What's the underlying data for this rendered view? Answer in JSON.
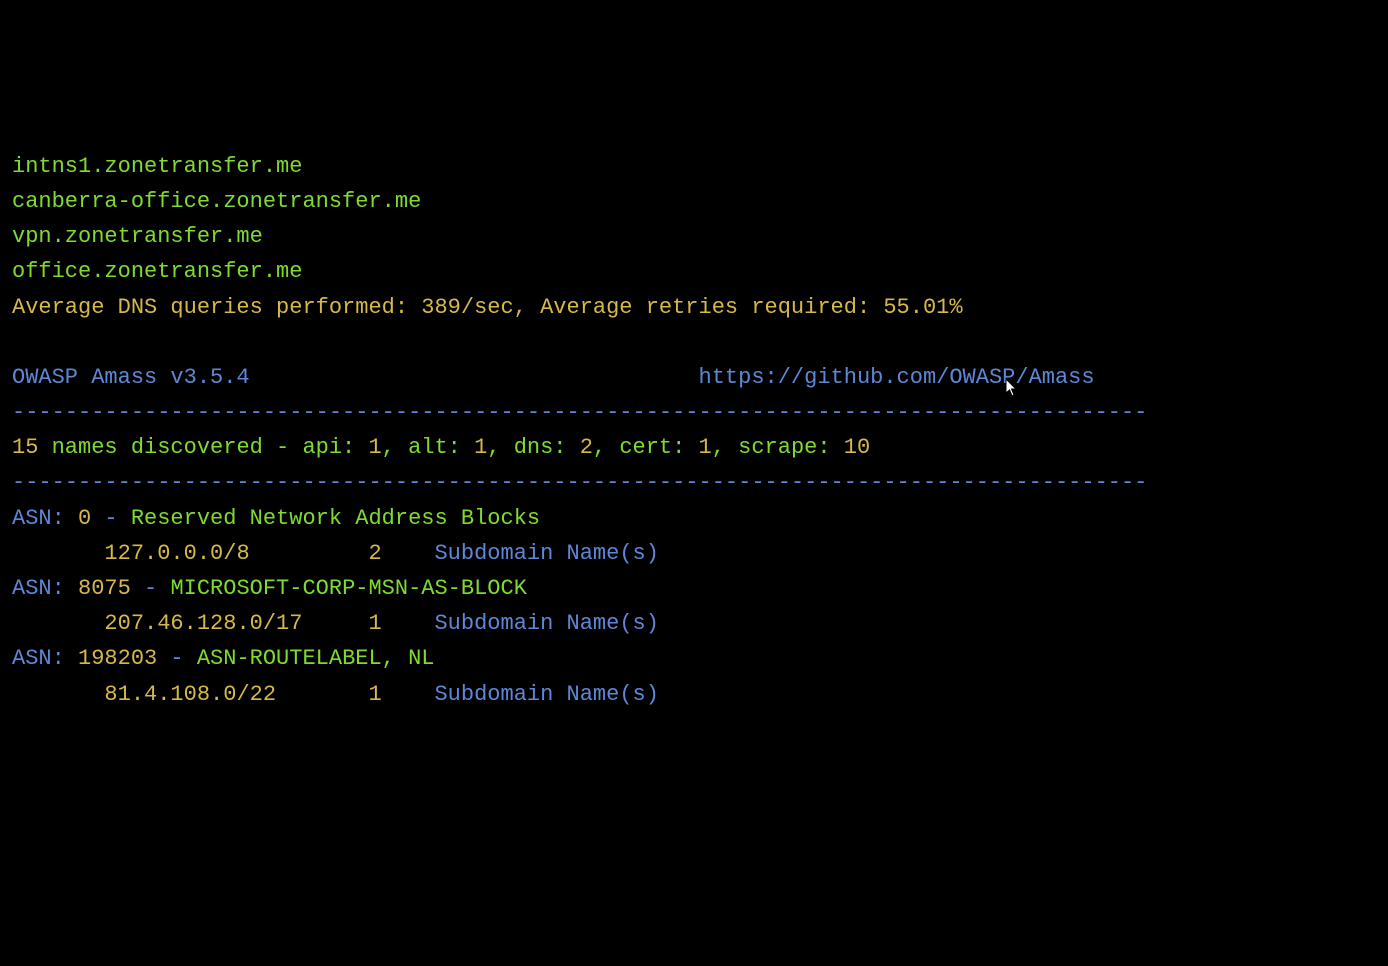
{
  "subdomains": [
    "intns1.zonetransfer.me",
    "canberra-office.zonetransfer.me",
    "vpn.zonetransfer.me",
    "office.zonetransfer.me"
  ],
  "stats_line": "Average DNS queries performed: 389/sec, Average retries required: 55.01%",
  "header": {
    "product": "OWASP Amass v3.5.4",
    "url": "https://github.com/OWASP/Amass"
  },
  "divider": "--------------------------------------------------------------------------------------",
  "summary": {
    "count": "15",
    "text_after_count": " names discovered - api: ",
    "api": "1",
    "sep_alt": ", alt: ",
    "alt": "1",
    "sep_dns": ", dns: ",
    "dns": "2",
    "sep_cert": ", cert: ",
    "cert": "1",
    "sep_scrape": ", scrape: ",
    "scrape": "10"
  },
  "asn": [
    {
      "label": "ASN: ",
      "num": "0",
      "dash": " - ",
      "name": "Reserved Network Address Blocks",
      "block_prefix": "       ",
      "block": "127.0.0.0/8         ",
      "count": "2    ",
      "suffix": "Subdomain Name(s)"
    },
    {
      "label": "ASN: ",
      "num": "8075",
      "dash": " - ",
      "name": "MICROSOFT-CORP-MSN-AS-BLOCK",
      "block_prefix": "       ",
      "block": "207.46.128.0/17     ",
      "count": "1    ",
      "suffix": "Subdomain Name(s)"
    },
    {
      "label": "ASN: ",
      "num": "198203",
      "dash": " - ",
      "name": "ASN-ROUTELABEL, NL",
      "block_prefix": "       ",
      "block": "81.4.108.0/22       ",
      "count": "1    ",
      "suffix": "Subdomain Name(s)"
    }
  ],
  "header_spacing": "                                  "
}
